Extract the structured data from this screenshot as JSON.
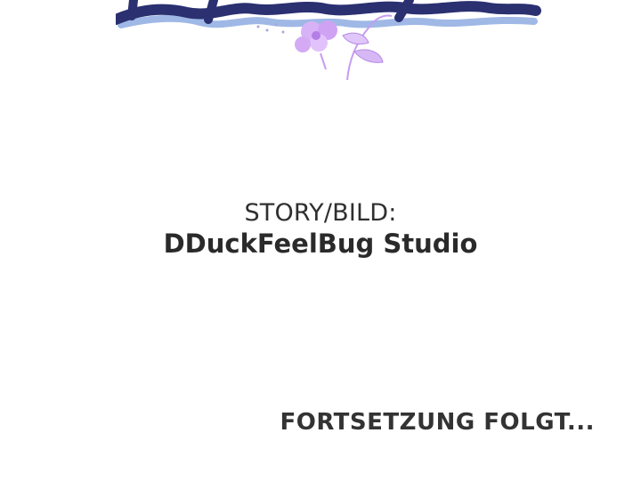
{
  "header": {
    "logo_text": "Die Maske",
    "logo_colors": {
      "fill": "#2a3070",
      "shadow": "#9fb8e6",
      "flower": "#c79cf1"
    }
  },
  "credits": {
    "label": "STORY/BILD:",
    "studio": "DDuckFeelBug Studio"
  },
  "footer": {
    "text": "FORTSETZUNG FOLGT..."
  }
}
